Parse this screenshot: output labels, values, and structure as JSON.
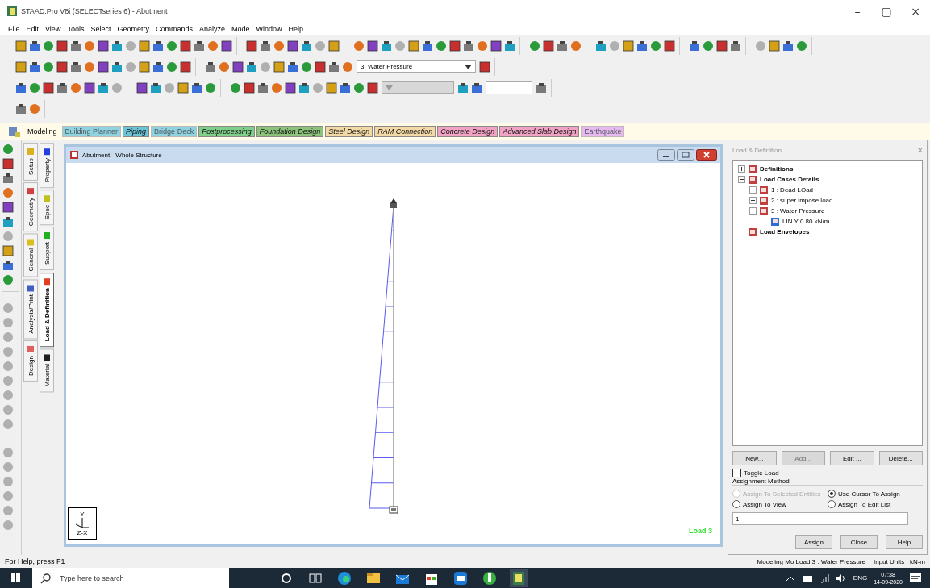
{
  "window": {
    "title": "STAAD.Pro V8i (SELECTseries 6) - Abutment",
    "controls": [
      "–",
      "▢",
      "×"
    ]
  },
  "menu": [
    "File",
    "Edit",
    "View",
    "Tools",
    "Select",
    "Geometry",
    "Commands",
    "Analyze",
    "Mode",
    "Window",
    "Help"
  ],
  "toolbar": {
    "load_case_select": "3: Water Pressure"
  },
  "module_tabs": {
    "label": "Modeling",
    "tabs": [
      {
        "label": "Building Planner",
        "color": "#8fd3e0",
        "disabled": true
      },
      {
        "label": "Piping",
        "color": "#6cc3d6",
        "disabled": false
      },
      {
        "label": "Bridge Deck",
        "color": "#8fd3e0",
        "disabled": true
      },
      {
        "label": "Postprocessing",
        "color": "#7fcf8a",
        "disabled": false
      },
      {
        "label": "Foundation Design",
        "color": "#8cc37a",
        "disabled": false
      },
      {
        "label": "Steel Design",
        "color": "#f2d9a6",
        "disabled": false
      },
      {
        "label": "RAM Connection",
        "color": "#f2d9a6",
        "disabled": false
      },
      {
        "label": "Concrete Design",
        "color": "#f0a3c4",
        "disabled": false
      },
      {
        "label": "Advanced Slab Design",
        "color": "#f0a3c4",
        "disabled": false
      },
      {
        "label": "Earthquake",
        "color": "#e8b8f0",
        "disabled": true
      }
    ]
  },
  "page_tabs": [
    [
      {
        "label": "Setup",
        "color": "#d9b020",
        "selected": false
      },
      {
        "label": "Geometry",
        "color": "#d04040",
        "selected": false
      },
      {
        "label": "General",
        "color": "#d9c020",
        "selected": false
      },
      {
        "label": "Analysis/Print",
        "color": "#4060c0",
        "selected": false
      },
      {
        "label": "Design",
        "color": "#e06060",
        "selected": false
      }
    ],
    [
      {
        "label": "Property",
        "color": "#2040e0",
        "selected": false
      },
      {
        "label": "Spec",
        "color": "#c0c020",
        "selected": false
      },
      {
        "label": "Support",
        "color": "#20b020",
        "selected": false
      },
      {
        "label": "Load & Definition",
        "color": "#e04020",
        "selected": true
      },
      {
        "label": "Material",
        "color": "#202020",
        "selected": false
      }
    ]
  ],
  "view_window": {
    "title": "Abutment - Whole Structure",
    "axis_y": "Y",
    "axis_x": "Z-X",
    "load_label": "Load 3"
  },
  "panel": {
    "title": "Load & Definition",
    "close": "×",
    "tree": [
      {
        "label": "Definitions",
        "bold": true,
        "expanded": false
      },
      {
        "label": "Load Cases Details",
        "bold": true,
        "expanded": true,
        "children": [
          {
            "label": "1 : Dead LOad",
            "bold": false,
            "expanded": false
          },
          {
            "label": "2 : super impose load",
            "bold": false,
            "expanded": false
          },
          {
            "label": "3 : Water Pressure",
            "bold": false,
            "expanded": true,
            "children": [
              {
                "label": "LIN Y 0 80 kN/m",
                "bold": false
              }
            ]
          }
        ]
      },
      {
        "label": "Load Envelopes",
        "bold": true
      }
    ],
    "buttons": [
      {
        "label": "New...",
        "disabled": false
      },
      {
        "label": "Add...",
        "disabled": true
      },
      {
        "label": "Edit ...",
        "disabled": false
      },
      {
        "label": "Delete...",
        "disabled": false
      }
    ],
    "toggle_load": {
      "label": "Toggle Load",
      "checked": false
    },
    "group_title": "Assignment Method",
    "radios": [
      {
        "label": "Assign To Selected Entities",
        "selected": false,
        "disabled": true
      },
      {
        "label": "Use Cursor To Assign",
        "selected": true,
        "disabled": false
      },
      {
        "label": "Assign To View",
        "selected": false,
        "disabled": false
      },
      {
        "label": "Assign To Edit List",
        "selected": false,
        "disabled": false
      }
    ],
    "edit_list": "1",
    "actions": [
      "Assign",
      "Close",
      "Help"
    ]
  },
  "status_bar": {
    "help": "For Help, press F1",
    "mode": "Modeling Mo Load 3 : Water Pressure",
    "units": "Input Units : kN-m"
  },
  "taskbar": {
    "search_placeholder": "Type here to search",
    "language": "ENG",
    "time": "07:38",
    "date": "14-09-2020"
  }
}
